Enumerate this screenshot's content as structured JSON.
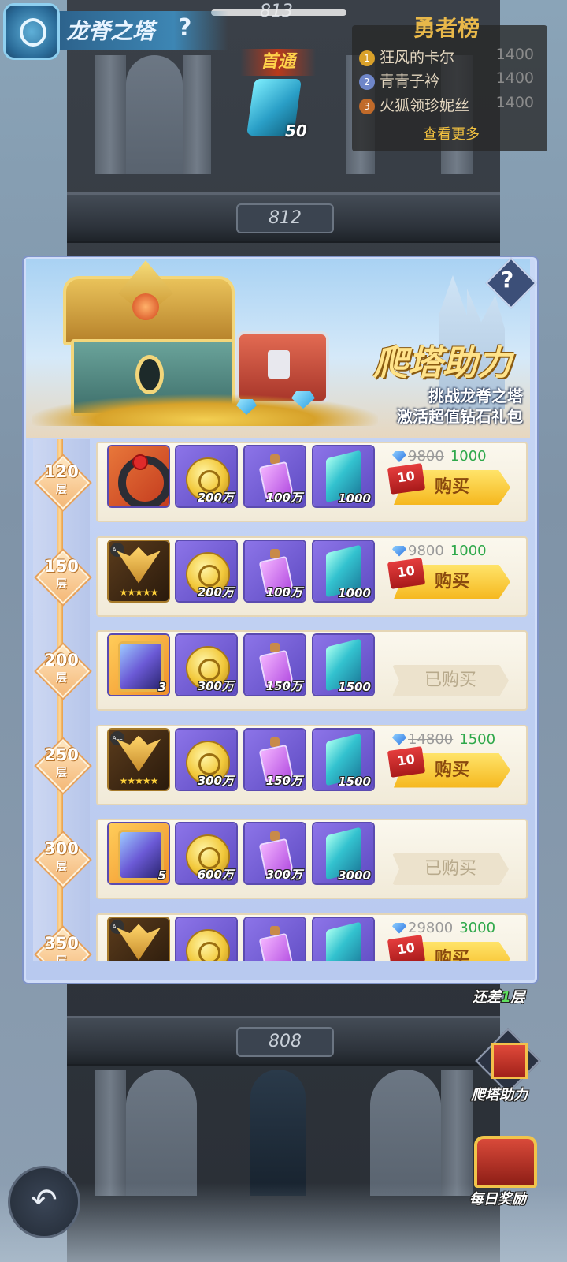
{
  "header": {
    "title": "龙脊之塔",
    "help": "?"
  },
  "top_floor": {
    "number": "813",
    "first_clear_label": "首通",
    "reward_count": "50"
  },
  "ranking": {
    "title": "勇者榜",
    "entries": [
      {
        "rank": "1",
        "name": "狂风的卡尔",
        "score": "1400",
        "color": "#d9a12a"
      },
      {
        "rank": "2",
        "name": "青青子衿",
        "score": "1400",
        "color": "#6f86c8"
      },
      {
        "rank": "3",
        "name": "火狐领珍妮丝",
        "score": "1400",
        "color": "#c06a2a"
      }
    ],
    "more_label": "查看更多"
  },
  "tower_floors": {
    "f812": "812",
    "f808": "808"
  },
  "modal": {
    "banner_title": "爬塔助力",
    "banner_sub1": "挑战龙脊之塔",
    "banner_sub2": "激活超值钻石礼包",
    "help": "?"
  },
  "unit": "层",
  "rows": [
    {
      "floor": "120",
      "hero": "ring",
      "hero_count": "",
      "hero_stars": "",
      "coins": "200万",
      "potions": "100万",
      "crystals": "1000",
      "old_price": "9800",
      "price": "1000",
      "discount": "10",
      "status": "buy",
      "buy_label": "购买"
    },
    {
      "floor": "150",
      "hero": "mask",
      "hero_count": "",
      "hero_stars": "★★★★★",
      "coins": "200万",
      "potions": "100万",
      "crystals": "1000",
      "old_price": "9800",
      "price": "1000",
      "discount": "10",
      "status": "buy",
      "buy_label": "购买"
    },
    {
      "floor": "200",
      "hero": "gem",
      "hero_count": "3",
      "hero_stars": "",
      "coins": "300万",
      "potions": "150万",
      "crystals": "1500",
      "old_price": "",
      "price": "",
      "discount": "",
      "status": "bought",
      "bought_label": "已购买"
    },
    {
      "floor": "250",
      "hero": "mask",
      "hero_count": "",
      "hero_stars": "★★★★★",
      "coins": "300万",
      "potions": "150万",
      "crystals": "1500",
      "old_price": "14800",
      "price": "1500",
      "discount": "10",
      "status": "buy",
      "buy_label": "购买"
    },
    {
      "floor": "300",
      "hero": "gem",
      "hero_count": "5",
      "hero_stars": "",
      "coins": "600万",
      "potions": "300万",
      "crystals": "3000",
      "old_price": "",
      "price": "",
      "discount": "",
      "status": "bought",
      "bought_label": "已购买"
    },
    {
      "floor": "350",
      "hero": "mask",
      "hero_count": "",
      "hero_stars": "",
      "coins": "",
      "potions": "",
      "crystals": "",
      "old_price": "29800",
      "price": "3000",
      "discount": "10",
      "status": "buy",
      "buy_label": "购买"
    }
  ],
  "side": {
    "remaining_prefix": "还差",
    "remaining_num": "1",
    "remaining_suffix": "层",
    "climb_help": "爬塔助力",
    "daily_reward": "每日奖励"
  },
  "icons": {
    "back": "back-arrow-icon"
  }
}
